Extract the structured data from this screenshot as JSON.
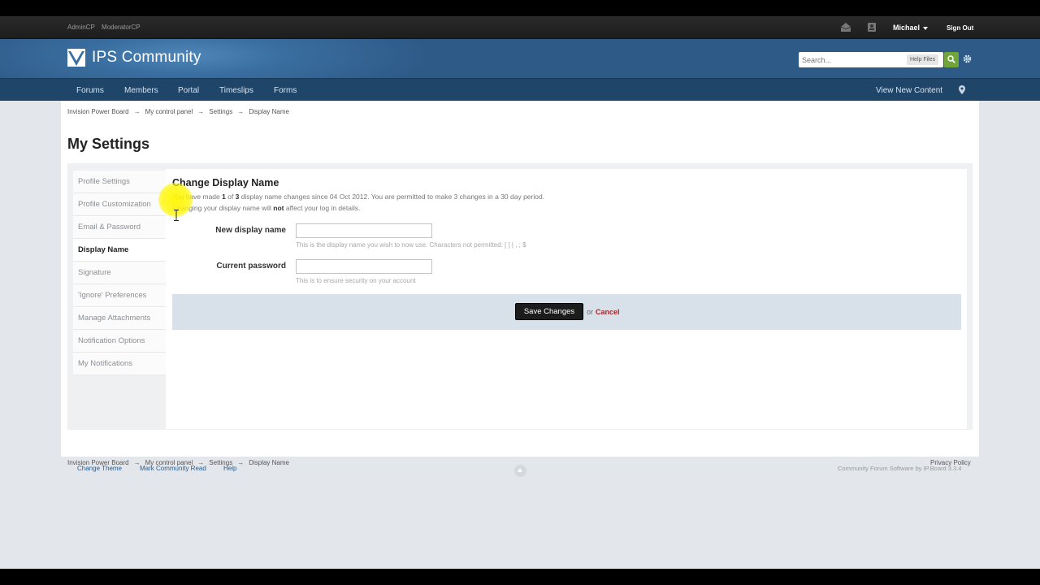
{
  "userbar": {
    "admin_links": [
      "AdminCP",
      "ModeratorCP"
    ],
    "user_name": "Michael",
    "sign_out": "Sign Out"
  },
  "branding": {
    "site_name": "IPS Community",
    "search_placeholder": "Search...",
    "help_files": "Help Files"
  },
  "nav": {
    "items": [
      "Forums",
      "Members",
      "Portal",
      "Timeslips",
      "Forms"
    ],
    "view_new_content": "View New Content"
  },
  "breadcrumb": {
    "items": [
      "Invision Power Board",
      "My control panel",
      "Settings",
      "Display Name"
    ],
    "separator": "→"
  },
  "page_title": "My Settings",
  "sidebar": {
    "items": [
      {
        "label": "Profile Settings",
        "active": false
      },
      {
        "label": "Profile Customization",
        "active": false
      },
      {
        "label": "Email & Password",
        "active": false
      },
      {
        "label": "Display Name",
        "active": true
      },
      {
        "label": "Signature",
        "active": false
      },
      {
        "label": "'Ignore' Preferences",
        "active": false
      },
      {
        "label": "Manage Attachments",
        "active": false
      },
      {
        "label": "Notification Options",
        "active": false
      },
      {
        "label": "My Notifications",
        "active": false
      }
    ]
  },
  "main": {
    "title": "Change Display Name",
    "info_line1_pre": "You have made ",
    "info_line1_made": "1",
    "info_line1_of": " of ",
    "info_line1_max": "3",
    "info_line1_post": " display name changes since 04 Oct 2012. You are permitted to make 3 changes in a 30 day period.",
    "info_line2_pre": "Changing your display name will ",
    "info_line2_bold": "not",
    "info_line2_post": " affect your log in details.",
    "fields": {
      "new_name": {
        "label": "New display name",
        "value": "",
        "description": "This is the display name you wish to now use. Characters not permitted: [ ] | , ; $"
      },
      "password": {
        "label": "Current password",
        "value": "",
        "description": "This is to ensure security on your account"
      }
    },
    "save_label": "Save Changes",
    "or_text": "or",
    "cancel_label": "Cancel"
  },
  "footer": {
    "privacy": "Privacy Policy",
    "links": [
      "Change Theme",
      "Mark Community Read",
      "Help"
    ],
    "copyright": "Community Forum Software by IP.Board 3.3.4"
  },
  "colors": {
    "brand_blue": "#2e5a87",
    "nav_blue": "#1f4569",
    "search_green": "#71a43a",
    "cancel_red": "#a32525"
  }
}
